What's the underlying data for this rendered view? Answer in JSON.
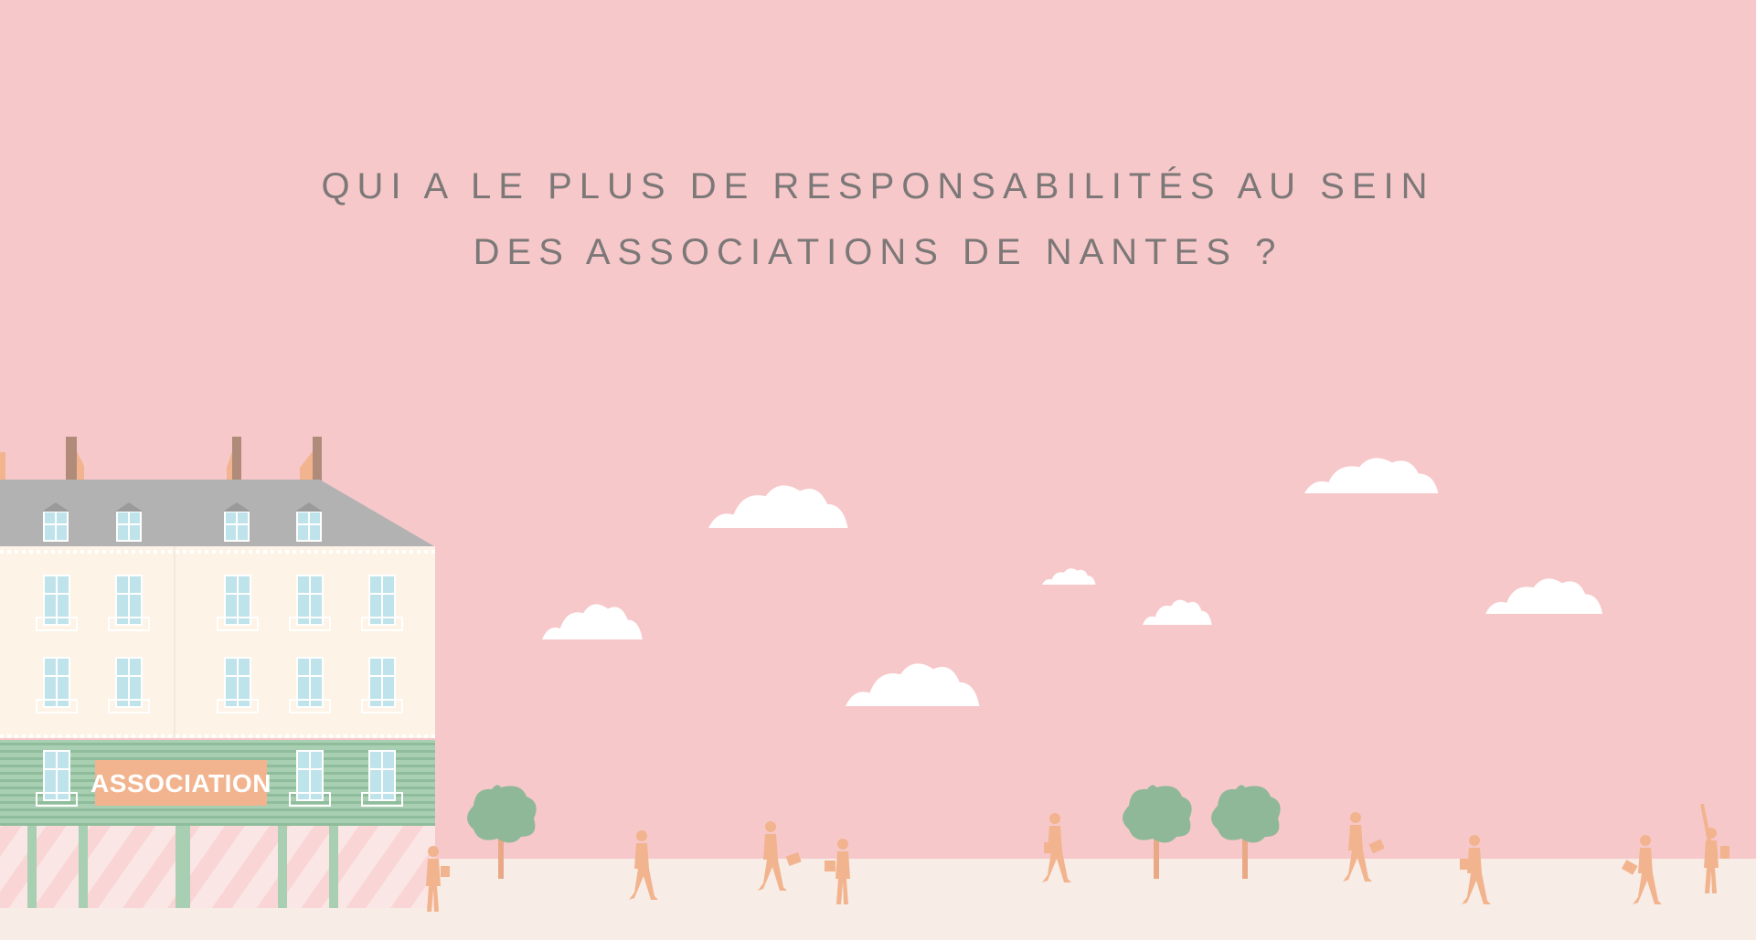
{
  "headline": {
    "line1": "QUI A LE PLUS DE RESPONSABILITÉS AU SEIN",
    "line2": "DES ASSOCIATIONS DE NANTES ?"
  },
  "building": {
    "sign": "ASSOCIATION"
  },
  "colors": {
    "sky": "#f7c8ca",
    "ground": "#f7ece6",
    "roof": "#b2b2b2",
    "facade": "#fdf3e6",
    "shopfront_stripe": "#97c3a3",
    "window": "#bfe3ea",
    "sign": "#f2b48e",
    "people": "#f2b48e",
    "tree": "#8fb898",
    "cloud": "#ffffff",
    "headline_text": "#7d7878"
  }
}
